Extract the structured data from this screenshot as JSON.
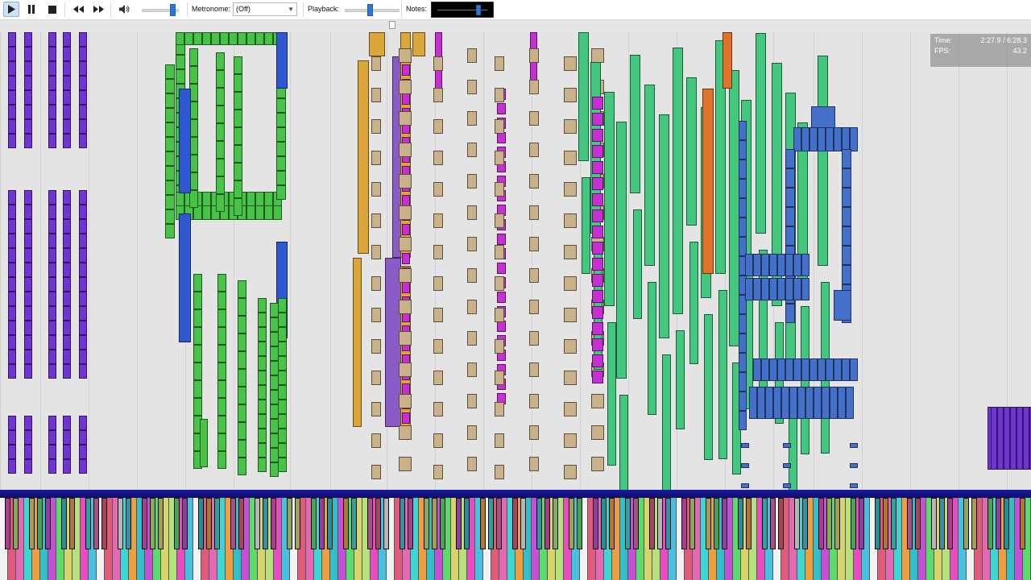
{
  "toolbar": {
    "metronome_label": "Metronome:",
    "metronome_value": "(Off)",
    "playback_label": "Playback:",
    "notes_label": "Notes:",
    "volume_level": 0.93,
    "playback_speed_level": 0.45,
    "notes_level": 0.85,
    "seek_position": 0.38
  },
  "stats": {
    "time_label": "Time:",
    "time_value": "2:27.9 / 6:28.3",
    "fps_label": "FPS:",
    "fps_value": "43.2"
  },
  "colors": {
    "green": "#47c447",
    "mint": "#43c77f",
    "blue": "#2d58d1",
    "steelblue": "#4570c9",
    "purple": "#7033d4",
    "tan": "#c9b28a",
    "gold": "#dba63a",
    "magenta": "#c52fd4",
    "orange": "#e0732a",
    "violet": "#8a5ac7",
    "keyboard_bar": "#1a1aa8"
  },
  "icons": {
    "play": "play-icon",
    "pause": "pause-icon",
    "stop": "stop-icon",
    "rewind": "rewind-icon",
    "fast_forward": "fast-forward-icon",
    "volume": "volume-icon"
  }
}
